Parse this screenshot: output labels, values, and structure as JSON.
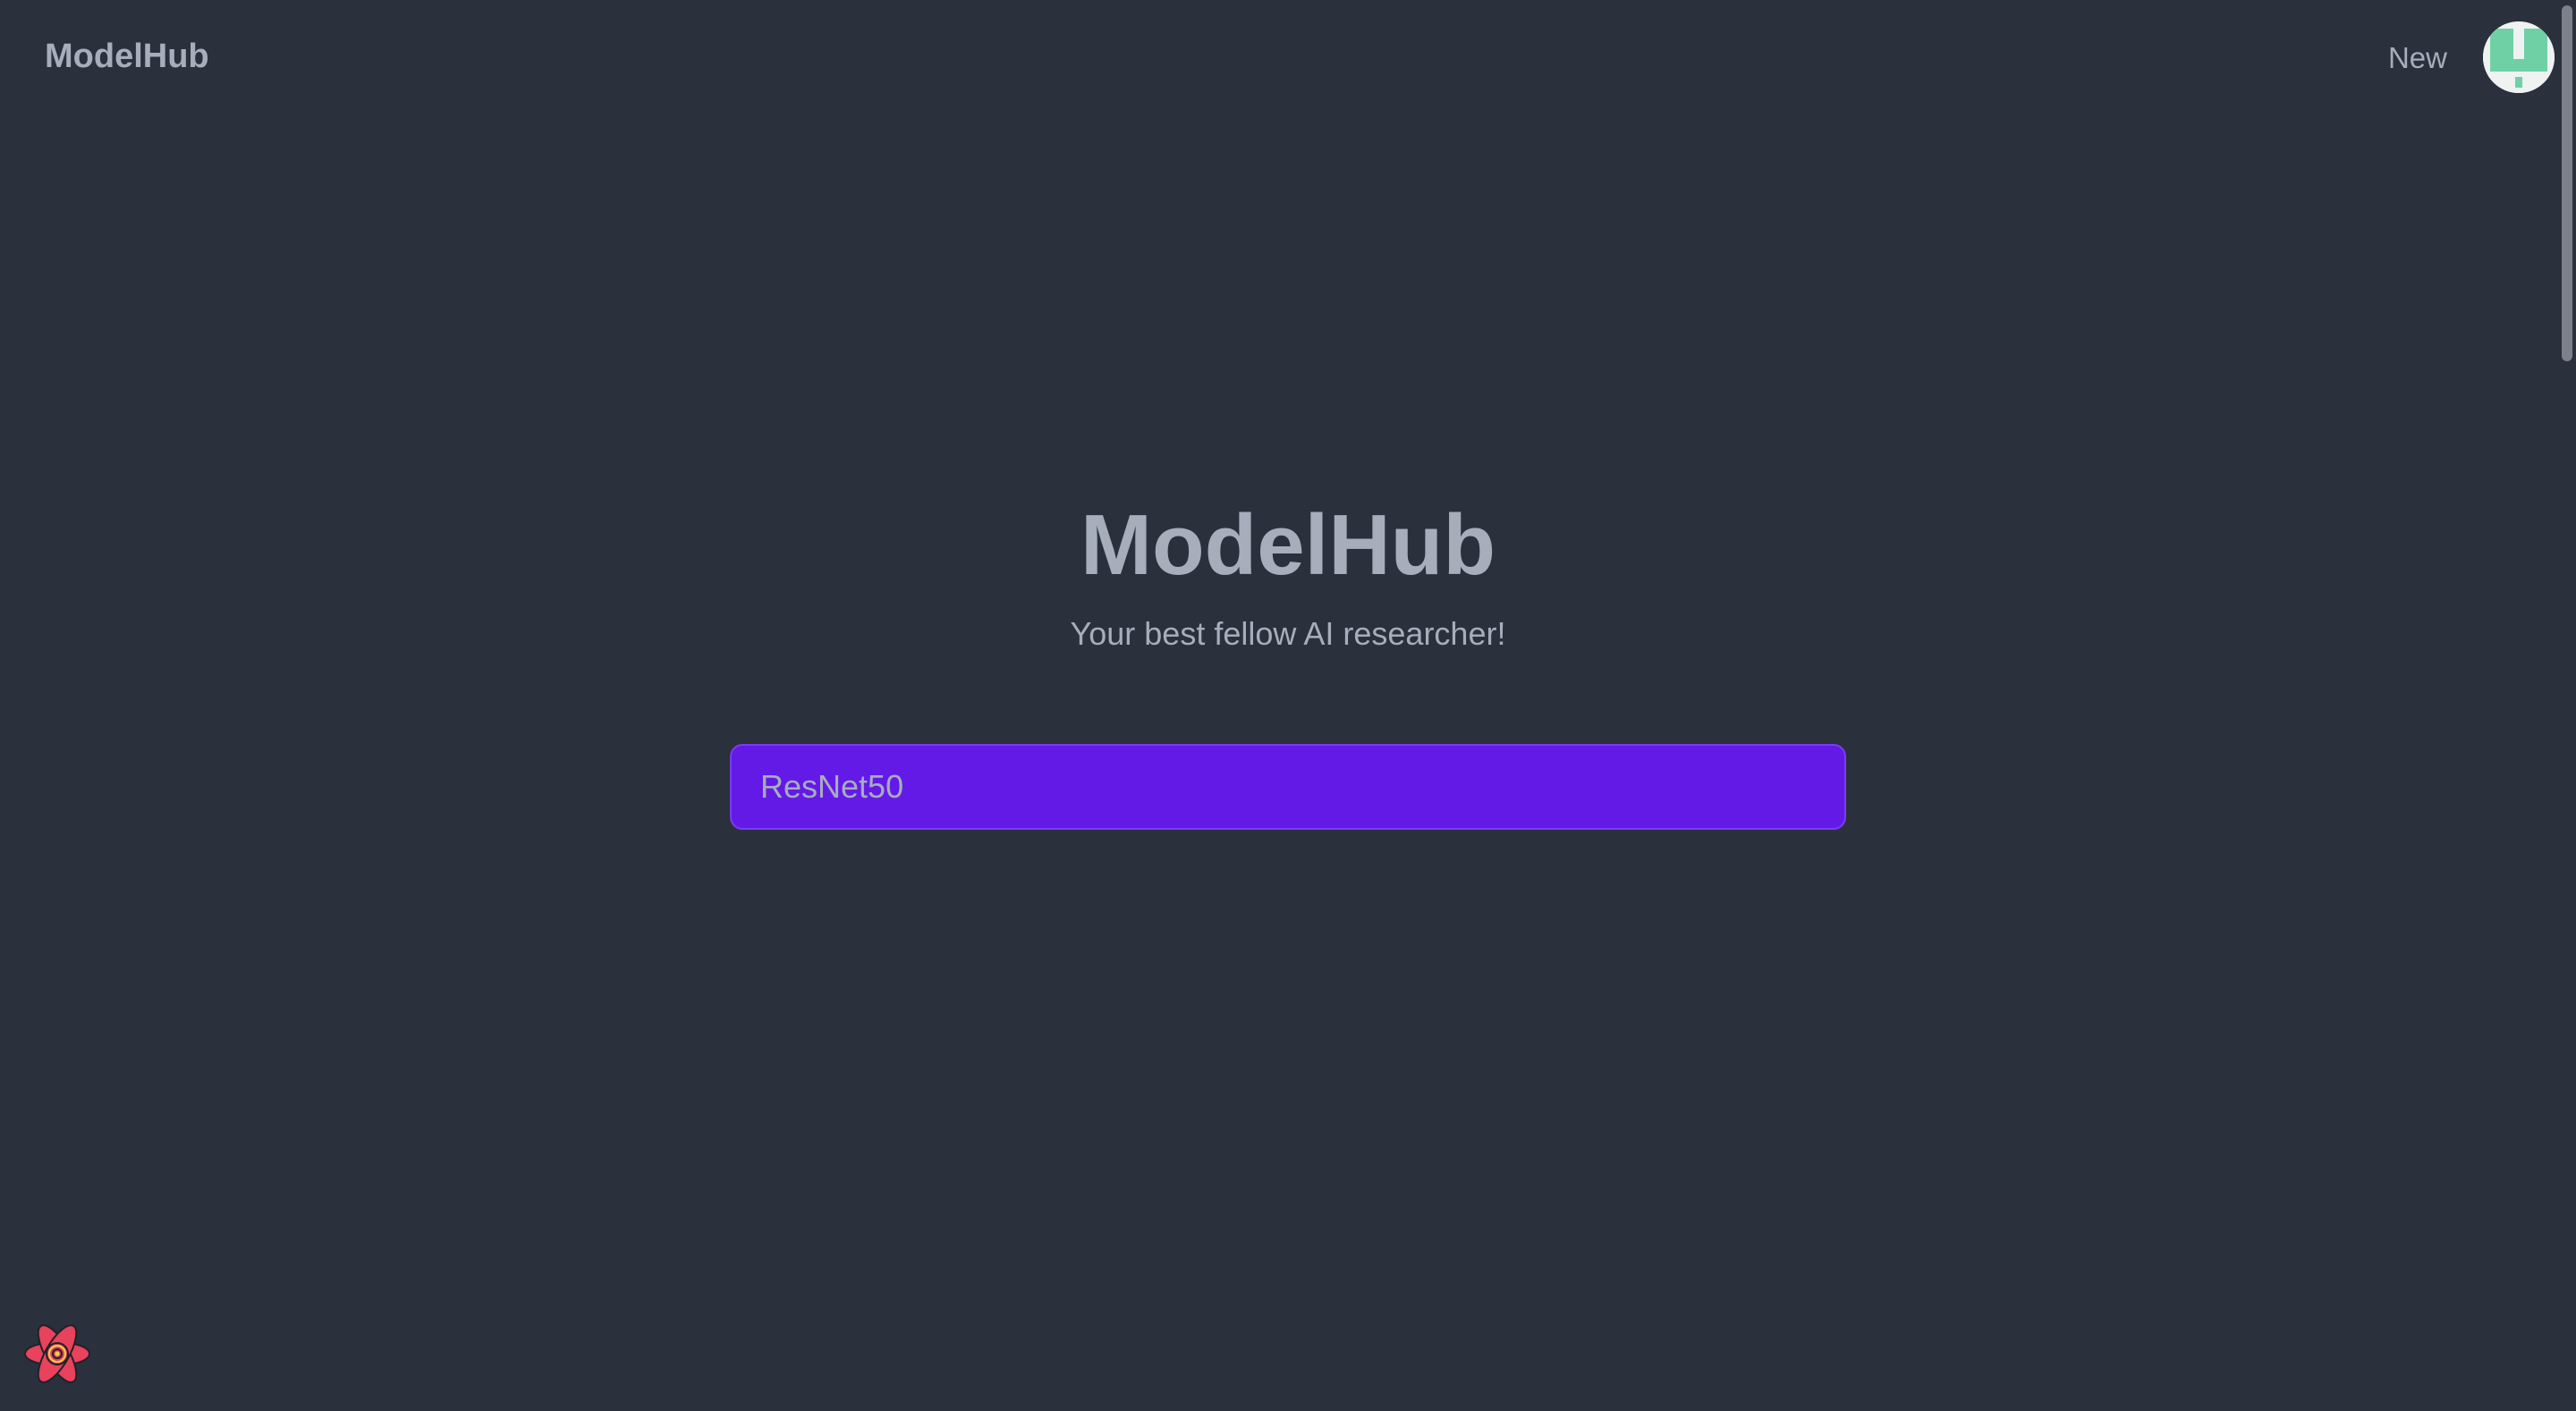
{
  "nav": {
    "brand": "ModelHub",
    "new_link": "New",
    "avatar_icon": "identicon-avatar"
  },
  "hero": {
    "title": "ModelHub",
    "subtitle": "Your best fellow AI researcher!"
  },
  "search": {
    "value": "ResNet50",
    "placeholder": ""
  },
  "colors": {
    "background": "#2a303c",
    "text": "#a6adbb",
    "search_bg": "#641ae6",
    "avatar_accent": "#6fd0a5"
  },
  "floating": {
    "devtools_icon": "react-logo-icon"
  }
}
